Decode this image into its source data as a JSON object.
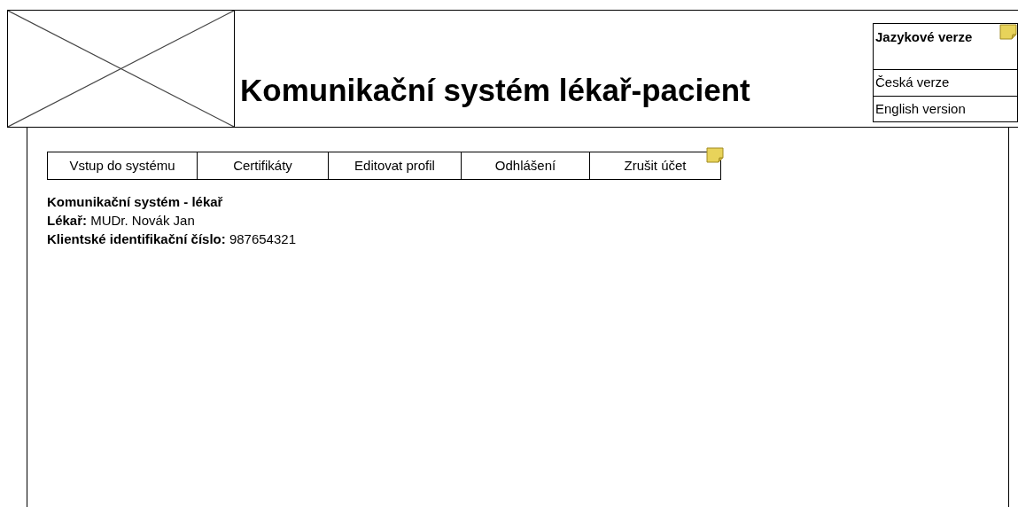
{
  "header": {
    "title": "Komunikační systém lékař-pacient"
  },
  "languages": {
    "title": "Jazykové verze",
    "items": [
      "Česká verze",
      "English version"
    ]
  },
  "menu": [
    "Vstup do systému",
    "Certifikáty",
    "Editovat profil",
    "Odhlášení",
    "Zrušit účet"
  ],
  "info": {
    "heading": "Komunikační systém - lékař",
    "fields": [
      {
        "label": "Lékař:",
        "value": "MUDr. Novák Jan"
      },
      {
        "label": "Klientské identifikační číslo:",
        "value": "987654321"
      }
    ]
  }
}
